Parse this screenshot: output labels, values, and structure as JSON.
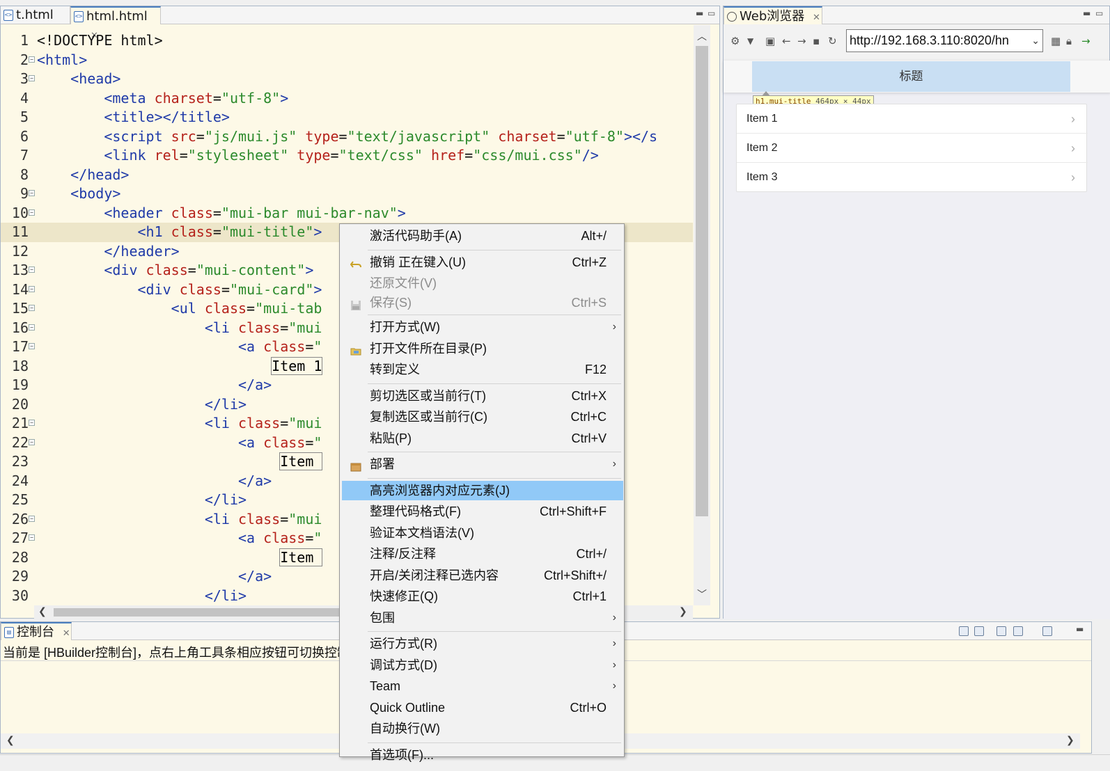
{
  "editor": {
    "tabs": [
      {
        "label": "t.html",
        "icon": "html-file-icon"
      },
      {
        "label": "html.html",
        "icon": "html-file-icon"
      }
    ],
    "lines": [
      {
        "n": "1",
        "s": [
          {
            "t": "txt",
            "v": "<!DOCTYPE html>"
          }
        ]
      },
      {
        "n": "2",
        "s": [
          {
            "t": "tag",
            "v": "<html>"
          }
        ]
      },
      {
        "n": "3",
        "s": [
          {
            "t": "txt",
            "v": "    "
          },
          {
            "t": "tag",
            "v": "<head>"
          }
        ]
      },
      {
        "n": "4",
        "s": [
          {
            "t": "txt",
            "v": "        "
          },
          {
            "t": "tag",
            "v": "<meta "
          },
          {
            "t": "attr",
            "v": "charset"
          },
          {
            "t": "txt",
            "v": "="
          },
          {
            "t": "val",
            "v": "\"utf-8\""
          },
          {
            "t": "tag",
            "v": ">"
          }
        ]
      },
      {
        "n": "5",
        "s": [
          {
            "t": "txt",
            "v": "        "
          },
          {
            "t": "tag",
            "v": "<title></title>"
          }
        ]
      },
      {
        "n": "6",
        "s": [
          {
            "t": "txt",
            "v": "        "
          },
          {
            "t": "tag",
            "v": "<script "
          },
          {
            "t": "attr",
            "v": "src"
          },
          {
            "t": "txt",
            "v": "="
          },
          {
            "t": "val",
            "v": "\"js/mui.js\""
          },
          {
            "t": "txt",
            "v": " "
          },
          {
            "t": "attr",
            "v": "type"
          },
          {
            "t": "txt",
            "v": "="
          },
          {
            "t": "val",
            "v": "\"text/javascript\""
          },
          {
            "t": "txt",
            "v": " "
          },
          {
            "t": "attr",
            "v": "charset"
          },
          {
            "t": "txt",
            "v": "="
          },
          {
            "t": "val",
            "v": "\"utf-8\""
          },
          {
            "t": "tag",
            "v": "></s"
          }
        ]
      },
      {
        "n": "7",
        "s": [
          {
            "t": "txt",
            "v": "        "
          },
          {
            "t": "tag",
            "v": "<link "
          },
          {
            "t": "attr",
            "v": "rel"
          },
          {
            "t": "txt",
            "v": "="
          },
          {
            "t": "val",
            "v": "\"stylesheet\""
          },
          {
            "t": "txt",
            "v": " "
          },
          {
            "t": "attr",
            "v": "type"
          },
          {
            "t": "txt",
            "v": "="
          },
          {
            "t": "val",
            "v": "\"text/css\""
          },
          {
            "t": "txt",
            "v": " "
          },
          {
            "t": "attr",
            "v": "href"
          },
          {
            "t": "txt",
            "v": "="
          },
          {
            "t": "val",
            "v": "\"css/mui.css\""
          },
          {
            "t": "tag",
            "v": "/>"
          }
        ]
      },
      {
        "n": "8",
        "s": [
          {
            "t": "txt",
            "v": "    "
          },
          {
            "t": "tag",
            "v": "</head>"
          }
        ]
      },
      {
        "n": "9",
        "s": [
          {
            "t": "txt",
            "v": "    "
          },
          {
            "t": "tag",
            "v": "<body>"
          }
        ]
      },
      {
        "n": "10",
        "s": [
          {
            "t": "txt",
            "v": "        "
          },
          {
            "t": "tag",
            "v": "<header "
          },
          {
            "t": "attr",
            "v": "class"
          },
          {
            "t": "txt",
            "v": "="
          },
          {
            "t": "val",
            "v": "\"mui-bar mui-bar-nav\""
          },
          {
            "t": "tag",
            "v": ">"
          }
        ]
      },
      {
        "n": "11",
        "s": [
          {
            "t": "txt",
            "v": "            "
          },
          {
            "t": "tag",
            "v": "<h1 "
          },
          {
            "t": "attr",
            "v": "class"
          },
          {
            "t": "txt",
            "v": "="
          },
          {
            "t": "val",
            "v": "\"mui-title\""
          },
          {
            "t": "tag",
            "v": ">"
          }
        ]
      },
      {
        "n": "12",
        "s": [
          {
            "t": "txt",
            "v": "        "
          },
          {
            "t": "tag",
            "v": "</header>"
          }
        ]
      },
      {
        "n": "13",
        "s": [
          {
            "t": "txt",
            "v": "        "
          },
          {
            "t": "tag",
            "v": "<div "
          },
          {
            "t": "attr",
            "v": "class"
          },
          {
            "t": "txt",
            "v": "="
          },
          {
            "t": "val",
            "v": "\"mui-content\""
          },
          {
            "t": "tag",
            "v": ">"
          }
        ]
      },
      {
        "n": "14",
        "s": [
          {
            "t": "txt",
            "v": "            "
          },
          {
            "t": "tag",
            "v": "<div "
          },
          {
            "t": "attr",
            "v": "class"
          },
          {
            "t": "txt",
            "v": "="
          },
          {
            "t": "val",
            "v": "\"mui-card\""
          },
          {
            "t": "tag",
            "v": ">"
          }
        ]
      },
      {
        "n": "15",
        "s": [
          {
            "t": "txt",
            "v": "                "
          },
          {
            "t": "tag",
            "v": "<ul "
          },
          {
            "t": "attr",
            "v": "class"
          },
          {
            "t": "txt",
            "v": "="
          },
          {
            "t": "val",
            "v": "\"mui-tab"
          }
        ]
      },
      {
        "n": "16",
        "s": [
          {
            "t": "txt",
            "v": "                    "
          },
          {
            "t": "tag",
            "v": "<li "
          },
          {
            "t": "attr",
            "v": "class"
          },
          {
            "t": "txt",
            "v": "="
          },
          {
            "t": "val",
            "v": "\"mui"
          }
        ]
      },
      {
        "n": "17",
        "s": [
          {
            "t": "txt",
            "v": "                        "
          },
          {
            "t": "tag",
            "v": "<a "
          },
          {
            "t": "attr",
            "v": "class"
          },
          {
            "t": "txt",
            "v": "="
          },
          {
            "t": "val",
            "v": "\""
          }
        ]
      },
      {
        "n": "18",
        "s": [
          {
            "t": "txt",
            "v": "                            "
          },
          {
            "t": "boxed",
            "v": "Item 1"
          }
        ]
      },
      {
        "n": "19",
        "s": [
          {
            "t": "txt",
            "v": "                        "
          },
          {
            "t": "tag",
            "v": "</a>"
          }
        ]
      },
      {
        "n": "20",
        "s": [
          {
            "t": "txt",
            "v": "                    "
          },
          {
            "t": "tag",
            "v": "</li>"
          }
        ]
      },
      {
        "n": "21",
        "s": [
          {
            "t": "txt",
            "v": "                    "
          },
          {
            "t": "tag",
            "v": "<li "
          },
          {
            "t": "attr",
            "v": "class"
          },
          {
            "t": "txt",
            "v": "="
          },
          {
            "t": "val",
            "v": "\"mui"
          }
        ]
      },
      {
        "n": "22",
        "s": [
          {
            "t": "txt",
            "v": "                        "
          },
          {
            "t": "tag",
            "v": "<a "
          },
          {
            "t": "attr",
            "v": "class"
          },
          {
            "t": "txt",
            "v": "="
          },
          {
            "t": "val",
            "v": "\""
          }
        ]
      },
      {
        "n": "23",
        "s": [
          {
            "t": "txt",
            "v": "                             "
          },
          {
            "t": "boxed",
            "v": "Item "
          }
        ]
      },
      {
        "n": "24",
        "s": [
          {
            "t": "txt",
            "v": "                        "
          },
          {
            "t": "tag",
            "v": "</a>"
          }
        ]
      },
      {
        "n": "25",
        "s": [
          {
            "t": "txt",
            "v": "                    "
          },
          {
            "t": "tag",
            "v": "</li>"
          }
        ]
      },
      {
        "n": "26",
        "s": [
          {
            "t": "txt",
            "v": "                    "
          },
          {
            "t": "tag",
            "v": "<li "
          },
          {
            "t": "attr",
            "v": "class"
          },
          {
            "t": "txt",
            "v": "="
          },
          {
            "t": "val",
            "v": "\"mui"
          }
        ]
      },
      {
        "n": "27",
        "s": [
          {
            "t": "txt",
            "v": "                        "
          },
          {
            "t": "tag",
            "v": "<a "
          },
          {
            "t": "attr",
            "v": "class"
          },
          {
            "t": "txt",
            "v": "="
          },
          {
            "t": "val",
            "v": "\""
          }
        ]
      },
      {
        "n": "28",
        "s": [
          {
            "t": "txt",
            "v": "                             "
          },
          {
            "t": "boxed",
            "v": "Item "
          }
        ]
      },
      {
        "n": "29",
        "s": [
          {
            "t": "txt",
            "v": "                        "
          },
          {
            "t": "tag",
            "v": "</a>"
          }
        ]
      },
      {
        "n": "30",
        "s": [
          {
            "t": "txt",
            "v": "                    "
          },
          {
            "t": "tag",
            "v": "</li>"
          }
        ]
      }
    ],
    "current_line": "11",
    "fold_lines": [
      "2",
      "3",
      "9",
      "10",
      "13",
      "14",
      "15",
      "16",
      "17",
      "21",
      "22",
      "26",
      "27"
    ]
  },
  "browser": {
    "tab_label": "Web浏览器",
    "url": "http://192.168.3.110:8020/hn",
    "page_title": "标题",
    "tooltip_selector": "h1.mui-title",
    "tooltip_width": "464",
    "tooltip_height": "44",
    "tooltip_unit": "px",
    "tooltip_times": "×",
    "items": [
      "Item 1",
      "Item 2",
      "Item 3"
    ]
  },
  "console": {
    "tab_label": "控制台",
    "message": "当前是 [HBuilder控制台]，点右上角工具条相应按钮可切换控制"
  },
  "context_menu": {
    "items": [
      {
        "label": "激活代码助手(A)",
        "shortcut": "Alt+/"
      },
      {
        "sep": true
      },
      {
        "label": "撤销 正在键入(U)",
        "shortcut": "Ctrl+Z",
        "icon": "undo-icon"
      },
      {
        "label": "还原文件(V)",
        "disabled": true
      },
      {
        "label": "保存(S)",
        "shortcut": "Ctrl+S",
        "disabled": true,
        "icon": "save-icon"
      },
      {
        "sep": true
      },
      {
        "label": "打开方式(W)",
        "submenu": true
      },
      {
        "label": "打开文件所在目录(P)",
        "icon": "folder-icon"
      },
      {
        "label": "转到定义",
        "shortcut": "F12"
      },
      {
        "sep": true
      },
      {
        "label": "剪切选区或当前行(T)",
        "shortcut": "Ctrl+X"
      },
      {
        "label": "复制选区或当前行(C)",
        "shortcut": "Ctrl+C"
      },
      {
        "label": "粘贴(P)",
        "shortcut": "Ctrl+V"
      },
      {
        "sep": true
      },
      {
        "label": "部署",
        "submenu": true,
        "icon": "package-icon"
      },
      {
        "sep": true
      },
      {
        "label": "高亮浏览器内对应元素(J)",
        "highlighted": true
      },
      {
        "label": "整理代码格式(F)",
        "shortcut": "Ctrl+Shift+F"
      },
      {
        "label": "验证本文档语法(V)"
      },
      {
        "label": "注释/反注释",
        "shortcut": "Ctrl+/"
      },
      {
        "label": "开启/关闭注释已选内容",
        "shortcut": "Ctrl+Shift+/"
      },
      {
        "label": "快速修正(Q)",
        "shortcut": "Ctrl+1"
      },
      {
        "label": "包围",
        "submenu": true
      },
      {
        "sep": true
      },
      {
        "label": "运行方式(R)",
        "submenu": true
      },
      {
        "label": "调试方式(D)",
        "submenu": true
      },
      {
        "label": "Team",
        "submenu": true
      },
      {
        "label": "Quick Outline",
        "shortcut": "Ctrl+O"
      },
      {
        "label": "自动换行(W)"
      },
      {
        "sep": true
      },
      {
        "label": "首选项(F)..."
      }
    ]
  }
}
